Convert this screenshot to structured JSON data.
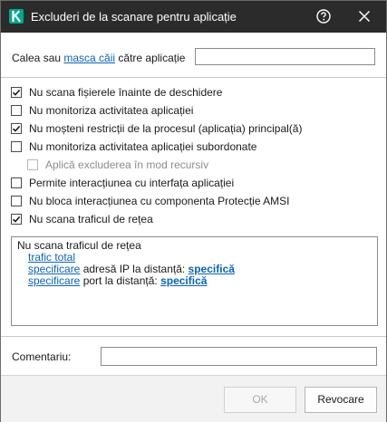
{
  "window": {
    "title": "Excluderi de la scanare pentru aplicație",
    "accent": "#00a88e"
  },
  "path": {
    "label_before": "Calea sau ",
    "label_link": "masca căii",
    "label_after": " către aplicație",
    "value": ""
  },
  "options": [
    {
      "label": "Nu scana fișierele înainte de deschidere",
      "checked": true,
      "enabled": true
    },
    {
      "label": "Nu monitoriza activitatea aplicației",
      "checked": false,
      "enabled": true
    },
    {
      "label": "Nu moșteni restricții de la procesul (aplicația) principal(ă)",
      "checked": true,
      "enabled": true
    },
    {
      "label": "Nu monitoriza activitatea aplicației subordonate",
      "checked": false,
      "enabled": true
    },
    {
      "label": "Aplică excluderea în mod recursiv",
      "checked": false,
      "enabled": false
    },
    {
      "label": "Permite interacțiunea cu interfața aplicației",
      "checked": false,
      "enabled": true
    },
    {
      "label": "Nu bloca interacțiunea cu componenta Protecție AMSI",
      "checked": false,
      "enabled": true
    },
    {
      "label": "Nu scana traficul de rețea",
      "checked": true,
      "enabled": true
    }
  ],
  "summary": {
    "heading": "Nu scana traficul de rețea",
    "traffic_link": "trafic total",
    "ip_link": "specificare",
    "ip_text": " adresă IP la distanță: ",
    "ip_value": "specifică",
    "port_link": "specificare",
    "port_text": " port la distanță: ",
    "port_value": "specifică"
  },
  "comment": {
    "label": "Comentariu:",
    "value": ""
  },
  "buttons": {
    "ok": "OK",
    "cancel": "Revocare"
  }
}
